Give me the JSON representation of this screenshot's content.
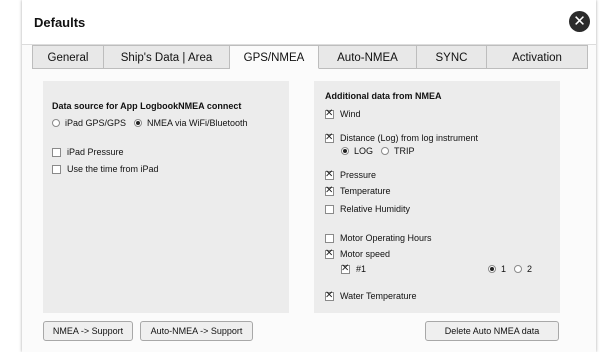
{
  "dialog": {
    "title": "Defaults",
    "close_symbol": "✕"
  },
  "tabs": [
    {
      "label": "General",
      "active": false
    },
    {
      "label": "Ship's Data  | Area",
      "active": false
    },
    {
      "label": "GPS/NMEA",
      "active": true
    },
    {
      "label": "Auto-NMEA",
      "active": false
    },
    {
      "label": "SYNC",
      "active": false
    },
    {
      "label": "Activation",
      "active": false
    }
  ],
  "left_panel": {
    "heading": "Data source for App LogbookNMEA connect",
    "source_options": [
      {
        "label": "iPad GPS/GPS",
        "selected": false
      },
      {
        "label": "NMEA via WiFi/Bluetooth",
        "selected": true
      }
    ],
    "ipad_pressure": {
      "label": "iPad Pressure",
      "checked": false
    },
    "use_time": {
      "label": "Use the time from iPad",
      "checked": false
    }
  },
  "right_panel": {
    "heading": "Additional data from NMEA",
    "wind": {
      "label": "Wind",
      "checked": true
    },
    "distance": {
      "label": "Distance (Log) from log instrument",
      "checked": true
    },
    "distance_options": [
      {
        "label": "LOG",
        "selected": true
      },
      {
        "label": "TRIP",
        "selected": false
      }
    ],
    "pressure": {
      "label": "Pressure",
      "checked": true
    },
    "temperature": {
      "label": "Temperature",
      "checked": true
    },
    "humidity": {
      "label": "Relative Humidity",
      "checked": false
    },
    "motor_hours": {
      "label": "Motor Operating Hours",
      "checked": false
    },
    "motor_speed": {
      "label": "Motor speed",
      "checked": true
    },
    "motor_1": {
      "label": "#1",
      "checked": true
    },
    "motor_speed_options": [
      {
        "label": "1",
        "selected": true
      },
      {
        "label": "2",
        "selected": false
      }
    ],
    "water_temp": {
      "label": "Water Temperature",
      "checked": true
    }
  },
  "buttons": {
    "nmea_support": "NMEA -> Support",
    "auto_nmea_support": "Auto-NMEA -> Support",
    "delete_auto_nmea": "Delete Auto NMEA data"
  }
}
